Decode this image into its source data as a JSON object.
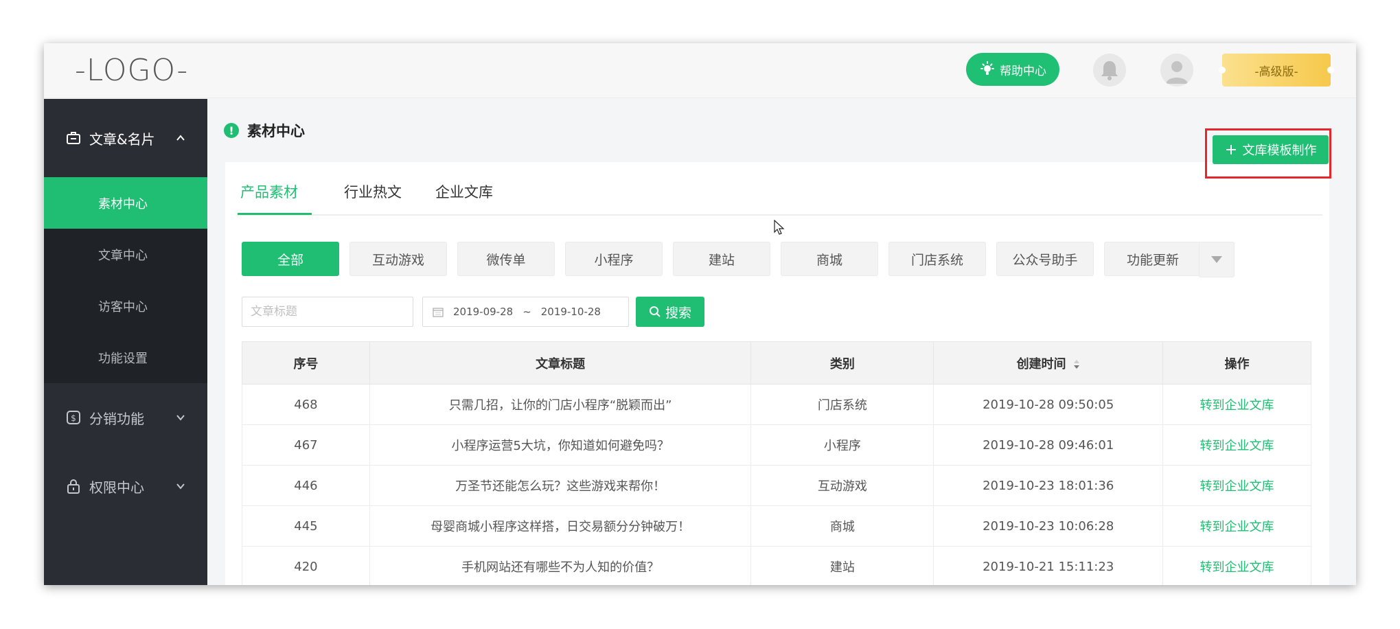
{
  "header": {
    "logo": "-LOGO-",
    "help_label": "帮助中心",
    "premium_label": "-高级版-"
  },
  "sidebar": {
    "groups": [
      {
        "label": "文章&名片",
        "icon": "briefcase-icon",
        "expanded": true
      },
      {
        "label": "分销功能",
        "icon": "coin-icon",
        "expanded": false
      },
      {
        "label": "权限中心",
        "icon": "lock-icon",
        "expanded": false
      }
    ],
    "items": [
      {
        "label": "素材中心",
        "active": true
      },
      {
        "label": "文章中心",
        "active": false
      },
      {
        "label": "访客中心",
        "active": false
      },
      {
        "label": "功能设置",
        "active": false
      }
    ]
  },
  "main": {
    "page_title": "素材中心",
    "add_button_label": "文库模板制作",
    "tabs": [
      {
        "label": "产品素材",
        "active": true
      },
      {
        "label": "行业热文",
        "active": false
      },
      {
        "label": "企业文库",
        "active": false
      }
    ],
    "categories": [
      "全部",
      "互动游戏",
      "微传单",
      "小程序",
      "建站",
      "商城",
      "门店系统",
      "公众号助手",
      "功能更新"
    ],
    "active_category": "全部",
    "search": {
      "title_placeholder": "文章标题",
      "date_start": "2019-09-28",
      "date_sep": "~",
      "date_end": "2019-10-28",
      "button_label": "搜索"
    },
    "table": {
      "columns": [
        "序号",
        "文章标题",
        "类别",
        "创建时间",
        "操作"
      ],
      "rows": [
        {
          "id": "468",
          "title": "只需几招，让你的门店小程序“脱颖而出”",
          "category": "门店系统",
          "created": "2019-10-28 09:50:05",
          "action": "转到企业文库"
        },
        {
          "id": "467",
          "title": "小程序运营5大坑，你知道如何避免吗？",
          "category": "小程序",
          "created": "2019-10-28 09:46:01",
          "action": "转到企业文库"
        },
        {
          "id": "446",
          "title": "万圣节还能怎么玩？这些游戏来帮你！",
          "category": "互动游戏",
          "created": "2019-10-23 18:01:36",
          "action": "转到企业文库"
        },
        {
          "id": "445",
          "title": "母婴商城小程序这样搭，日交易额分分钟破万！",
          "category": "商城",
          "created": "2019-10-23 10:06:28",
          "action": "转到企业文库"
        },
        {
          "id": "420",
          "title": "手机网站还有哪些不为人知的价值？",
          "category": "建站",
          "created": "2019-10-21 15:11:23",
          "action": "转到企业文库"
        }
      ]
    }
  },
  "colors": {
    "accent": "#1fbe72",
    "sidebar_bg": "#2a2d33",
    "highlight": "#e5262a",
    "premium": "#f6c94b"
  }
}
